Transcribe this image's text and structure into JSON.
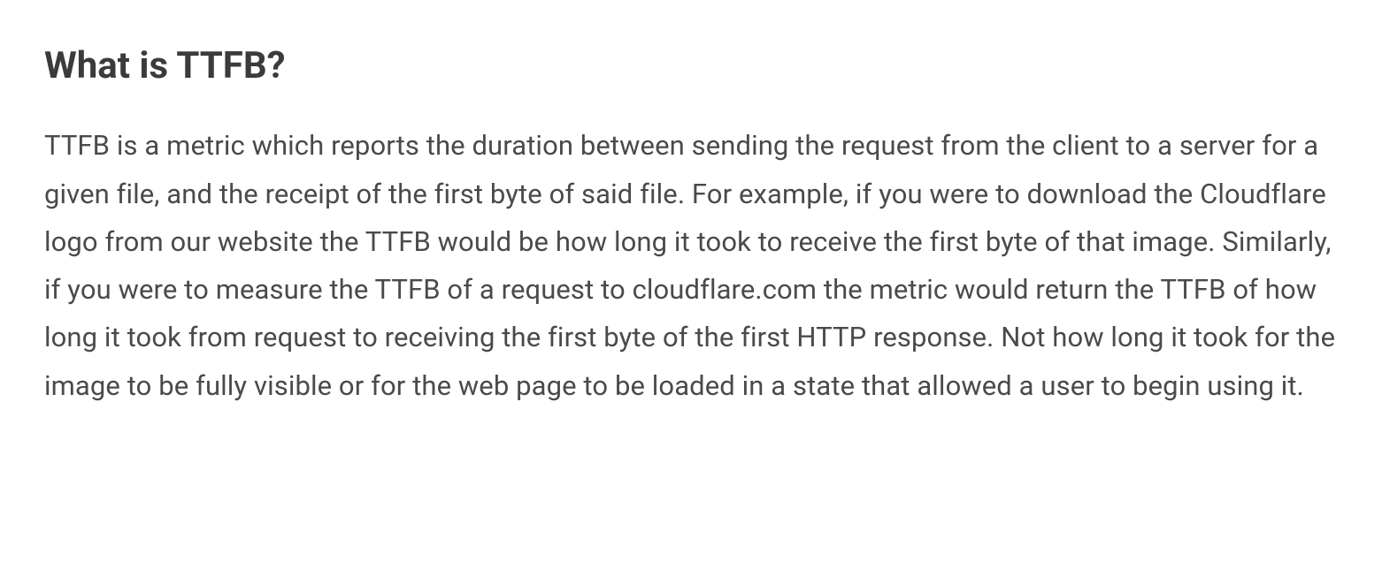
{
  "article": {
    "heading": "What is TTFB?",
    "body": "TTFB is a metric which reports the duration between sending the request from the client to a server for a given file, and the receipt of the first byte of said file. For example, if you were to download the Cloudflare logo from our website the TTFB would be how long it took to receive the first byte of that image. Similarly, if you were to measure the TTFB of a request to cloudflare.com the metric would return the TTFB of how long it took from request to receiving the first byte of the first HTTP response. Not how long it took for the image to be fully visible or for the web page to be loaded in a state that allowed a user to begin using it."
  }
}
